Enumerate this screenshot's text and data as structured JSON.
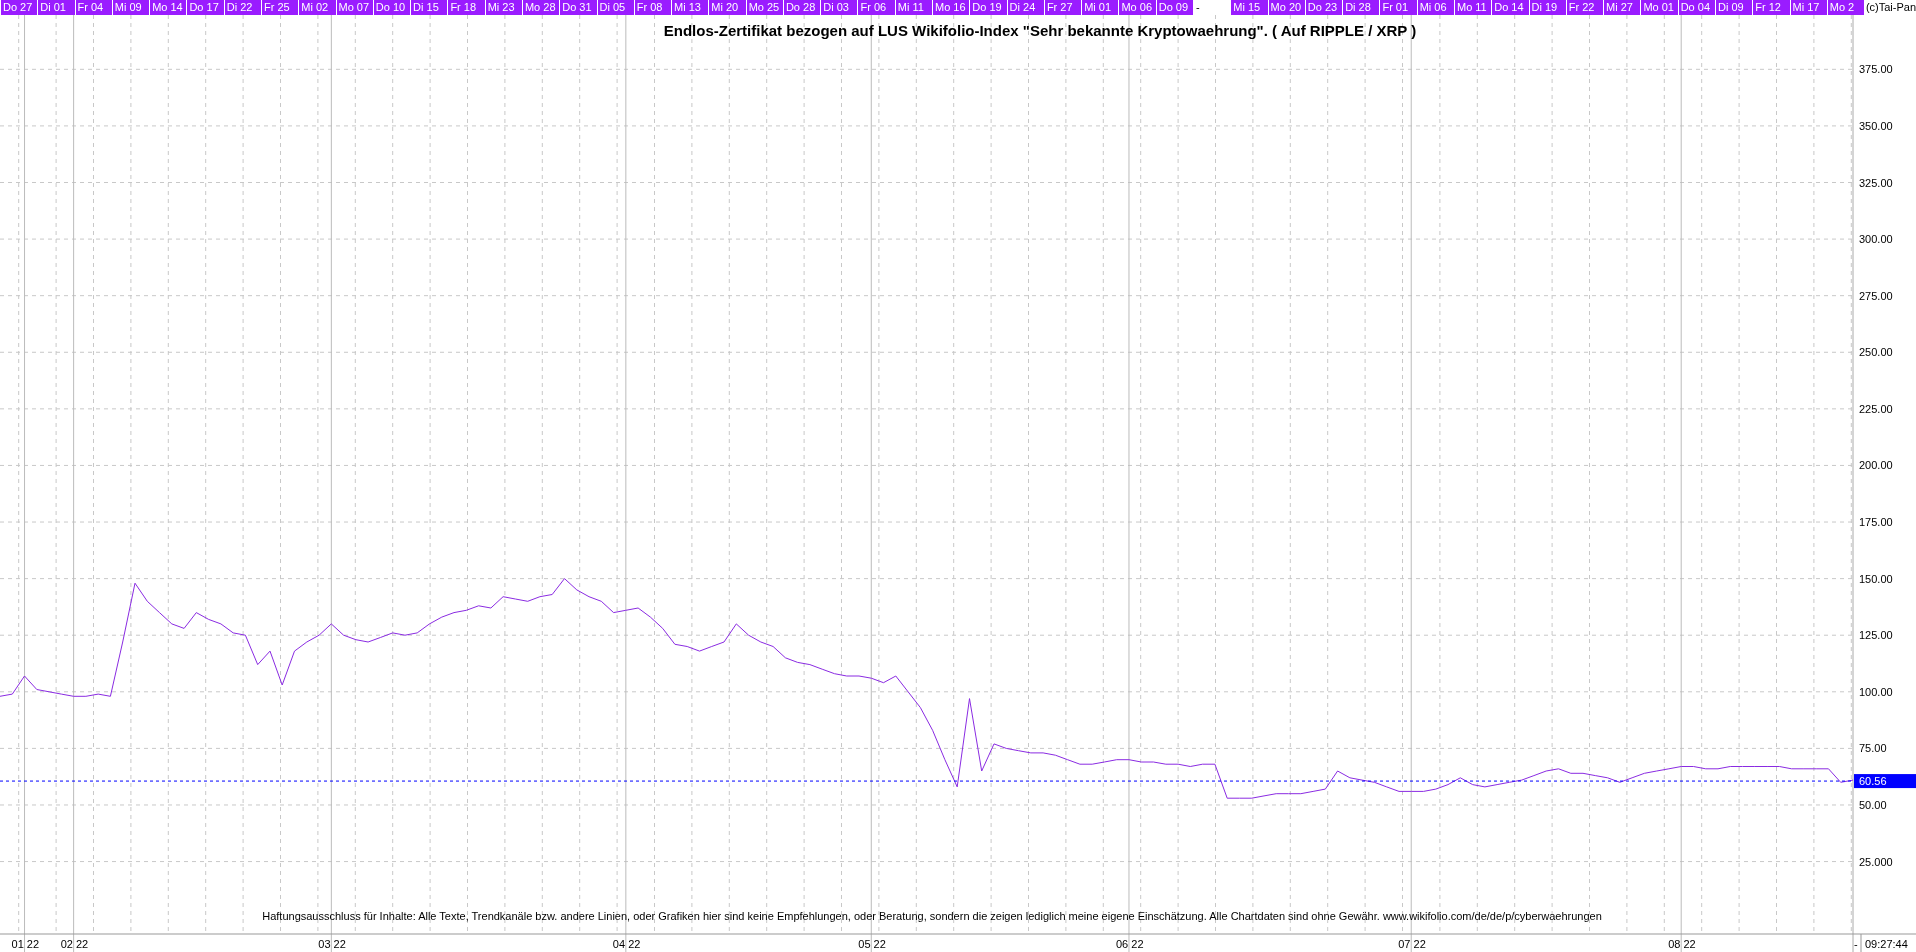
{
  "top_bar": {
    "dates": [
      {
        "label": "Do 27",
        "kind": "day"
      },
      {
        "label": "Di 01",
        "kind": "day"
      },
      {
        "label": "Fr 04",
        "kind": "day"
      },
      {
        "label": "Mi 09",
        "kind": "day"
      },
      {
        "label": "Mo 14",
        "kind": "day"
      },
      {
        "label": "Do 17",
        "kind": "day"
      },
      {
        "label": "Di 22",
        "kind": "day"
      },
      {
        "label": "Fr 25",
        "kind": "day"
      },
      {
        "label": "Mi 02",
        "kind": "day"
      },
      {
        "label": "Mo 07",
        "kind": "day"
      },
      {
        "label": "Do 10",
        "kind": "day"
      },
      {
        "label": "Di 15",
        "kind": "day"
      },
      {
        "label": "Fr 18",
        "kind": "day"
      },
      {
        "label": "Mi 23",
        "kind": "day"
      },
      {
        "label": "Mo 28",
        "kind": "day"
      },
      {
        "label": "Do 31",
        "kind": "day"
      },
      {
        "label": "Di 05",
        "kind": "day"
      },
      {
        "label": "Fr 08",
        "kind": "day"
      },
      {
        "label": "Mi 13",
        "kind": "day"
      },
      {
        "label": "Mi 20",
        "kind": "day"
      },
      {
        "label": "Mo 25",
        "kind": "day"
      },
      {
        "label": "Do 28",
        "kind": "day"
      },
      {
        "label": "Di 03",
        "kind": "day"
      },
      {
        "label": "Fr 06",
        "kind": "day"
      },
      {
        "label": "Mi 11",
        "kind": "day"
      },
      {
        "label": "Mo 16",
        "kind": "day"
      },
      {
        "label": "Do 19",
        "kind": "day"
      },
      {
        "label": "Di 24",
        "kind": "day"
      },
      {
        "label": "Fr 27",
        "kind": "day"
      },
      {
        "label": "Mi 01",
        "kind": "day"
      },
      {
        "label": "Mo 06",
        "kind": "day"
      },
      {
        "label": "Do 09",
        "kind": "day"
      },
      {
        "label": "-",
        "kind": "gap"
      },
      {
        "label": "Mi 15",
        "kind": "day"
      },
      {
        "label": "Mo 20",
        "kind": "day"
      },
      {
        "label": "Do 23",
        "kind": "day"
      },
      {
        "label": "Di 28",
        "kind": "day"
      },
      {
        "label": "Fr 01",
        "kind": "day"
      },
      {
        "label": "Mi 06",
        "kind": "day"
      },
      {
        "label": "Mo 11",
        "kind": "day"
      },
      {
        "label": "Do 14",
        "kind": "day"
      },
      {
        "label": "Di 19",
        "kind": "day"
      },
      {
        "label": "Fr 22",
        "kind": "day"
      },
      {
        "label": "Mi 27",
        "kind": "day"
      },
      {
        "label": "Mo 01",
        "kind": "day"
      },
      {
        "label": "Do 04",
        "kind": "day"
      },
      {
        "label": "Di 09",
        "kind": "day"
      },
      {
        "label": "Fr 12",
        "kind": "day"
      },
      {
        "label": "Mi 17",
        "kind": "day"
      },
      {
        "label": "Mo 2",
        "kind": "day"
      }
    ],
    "copyright": "(c)Tai-Pan"
  },
  "chart": {
    "title": "Endlos-Zertifikat bezogen auf LUS Wikifolio-Index \"Sehr bekannte Kryptowaehrung\". ( Auf RIPPLE / XRP )",
    "disclaimer": "Haftungsausschluss für Inhalte: Alle Texte, Trendkanäle bzw. andere Linien, oder Grafiken hier sind keine Empfehlungen, oder Beratung, sondern die zeigen lediglich meine eigene Einschätzung. Alle Chartdaten sind ohne Gewähr.  www.wikifolio.com/de/de/p/cyberwaehrungen",
    "axis_marker": "-",
    "time": "09:27:44",
    "chart_data": {
      "type": "line",
      "ylim": [
        -7,
        399
      ],
      "categories": [
        null,
        null,
        "01 22",
        null,
        null,
        null,
        "02 22",
        null,
        null,
        null,
        null,
        null,
        null,
        null,
        null,
        null,
        null,
        null,
        null,
        null,
        null,
        null,
        null,
        null,
        null,
        null,
        null,
        "03 22",
        null,
        null,
        null,
        null,
        null,
        null,
        null,
        null,
        null,
        null,
        null,
        null,
        null,
        null,
        null,
        null,
        null,
        null,
        null,
        null,
        null,
        null,
        null,
        "04 22",
        null,
        null,
        null,
        null,
        null,
        null,
        null,
        null,
        null,
        null,
        null,
        null,
        null,
        null,
        null,
        null,
        null,
        null,
        null,
        "05 22",
        null,
        null,
        null,
        null,
        null,
        null,
        null,
        null,
        null,
        null,
        null,
        null,
        null,
        null,
        null,
        null,
        null,
        null,
        null,
        null,
        "06 22",
        null,
        null,
        null,
        null,
        null,
        null,
        null,
        null,
        null,
        null,
        null,
        null,
        null,
        null,
        null,
        null,
        null,
        null,
        null,
        null,
        null,
        null,
        "07 22",
        null,
        null,
        null,
        null,
        null,
        null,
        null,
        null,
        null,
        null,
        null,
        null,
        null,
        null,
        null,
        null,
        null,
        null,
        null,
        null,
        null,
        "08 22",
        null,
        null,
        null,
        null,
        null,
        null,
        null,
        null,
        null,
        null,
        null,
        null,
        null,
        null
      ],
      "yticks": [
        {
          "value": 375,
          "label": "375.00"
        },
        {
          "value": 350,
          "label": "350.00"
        },
        {
          "value": 325,
          "label": "325.00"
        },
        {
          "value": 300,
          "label": "300.00"
        },
        {
          "value": 275,
          "label": "275.00"
        },
        {
          "value": 250,
          "label": "250.00"
        },
        {
          "value": 225,
          "label": "225.00"
        },
        {
          "value": 200,
          "label": "200.00"
        },
        {
          "value": 175,
          "label": "175.00"
        },
        {
          "value": 150,
          "label": "150.00"
        },
        {
          "value": 125,
          "label": "125.00"
        },
        {
          "value": 100,
          "label": "100.00"
        },
        {
          "value": 75,
          "label": "75.00"
        },
        {
          "value": 50,
          "label": "50.00"
        },
        {
          "value": 25,
          "label": "25.000"
        }
      ],
      "series": [
        {
          "color": "#8a2be2",
          "values": [
            98,
            99,
            107,
            101,
            100,
            99,
            98,
            98,
            99,
            98,
            122,
            148,
            140,
            135,
            130,
            128,
            135,
            132,
            130,
            126,
            125,
            112,
            118,
            103,
            118,
            122,
            125,
            130,
            125,
            123,
            122,
            124,
            126,
            125,
            126,
            130,
            133,
            135,
            136,
            138,
            137,
            142,
            141,
            140,
            142,
            143,
            150,
            145,
            142,
            140,
            135,
            136,
            137,
            133,
            128,
            121,
            120,
            118,
            120,
            122,
            130,
            125,
            122,
            120,
            115,
            113,
            112,
            110,
            108,
            107,
            107,
            106,
            104,
            107,
            100,
            93,
            83,
            70,
            58,
            97,
            65,
            77,
            75,
            74,
            73,
            73,
            72,
            70,
            68,
            68,
            69,
            70,
            70,
            69,
            69,
            68,
            68,
            67,
            68,
            68,
            53,
            53,
            53,
            54,
            55,
            55,
            55,
            56,
            57,
            65,
            62,
            61,
            60,
            58,
            56,
            56,
            56,
            57,
            59,
            62,
            59,
            58,
            59,
            60,
            61,
            63,
            65,
            66,
            64,
            64,
            63,
            62,
            60,
            62,
            64,
            65,
            66,
            67,
            67,
            66,
            66,
            67,
            67,
            67,
            67,
            67,
            66,
            66,
            66,
            66,
            60,
            61
          ]
        }
      ],
      "grid": true,
      "ref_lines": [
        {
          "axis": "y",
          "value": 60.56,
          "label": "60.56",
          "color": "#0000ff"
        }
      ]
    }
  }
}
